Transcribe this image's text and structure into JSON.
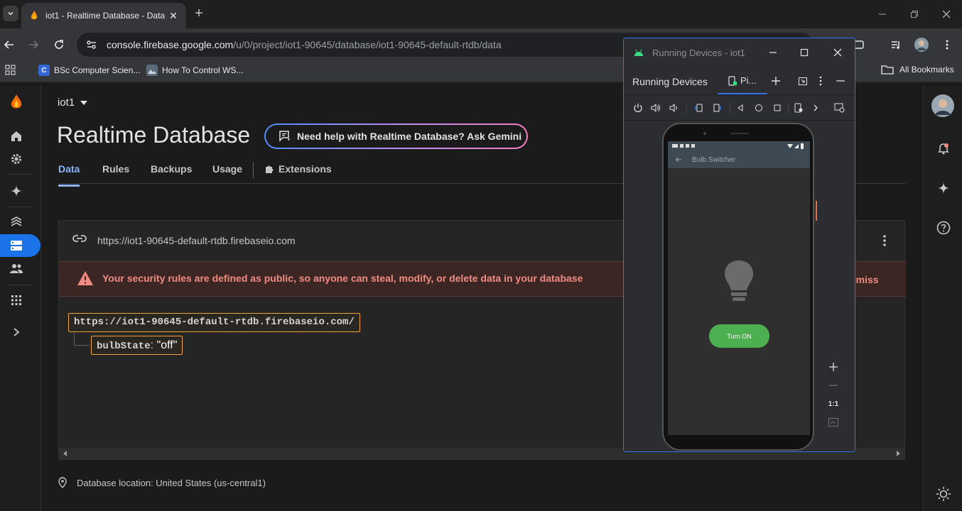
{
  "browser": {
    "tab_title": "iot1 - Realtime Database - Data",
    "url_host": "console.firebase.google.com",
    "url_path": "/u/0/project/iot1-90645/database/iot1-90645-default-rtdb/data",
    "bookmarks": [
      {
        "label": "BSc Computer Scien...",
        "icon": "c-icon"
      },
      {
        "label": "How To Control WS...",
        "icon": "image-icon"
      }
    ],
    "all_bookmarks": "All Bookmarks"
  },
  "firebase": {
    "project": "iot1",
    "page_title": "Realtime Database",
    "gemini_button": "Need help with Realtime Database? Ask Gemini",
    "tabs": [
      {
        "label": "Data",
        "active": true
      },
      {
        "label": "Rules"
      },
      {
        "label": "Backups"
      },
      {
        "label": "Usage"
      },
      {
        "label": "Extensions"
      }
    ],
    "db_url": "https://iot1-90645-default-rtdb.firebaseio.com",
    "warning": "Your security rules are defined as public, so anyone can steal, modify, or delete data in your database",
    "dismiss": "ismiss",
    "root_node": "https://iot1-90645-default-rtdb.firebaseio.com/",
    "child_key": "bulbState",
    "child_sep": ": ",
    "child_value": "\"off\"",
    "location": "Database location: United States (us-central1)"
  },
  "running_devices": {
    "window_title": "Running Devices - iot1",
    "panel_title": "Running Devices",
    "device_tab": "Pi...",
    "app": {
      "title": "Bulb Switcher",
      "button": "Turn ON"
    },
    "zoom_label": "1:1"
  },
  "colors": {
    "accent": "#8ab4f8",
    "warning": "#f28b82",
    "node_border": "#f2a33a",
    "button_green": "#4caf50",
    "window_border": "#3574f0"
  }
}
